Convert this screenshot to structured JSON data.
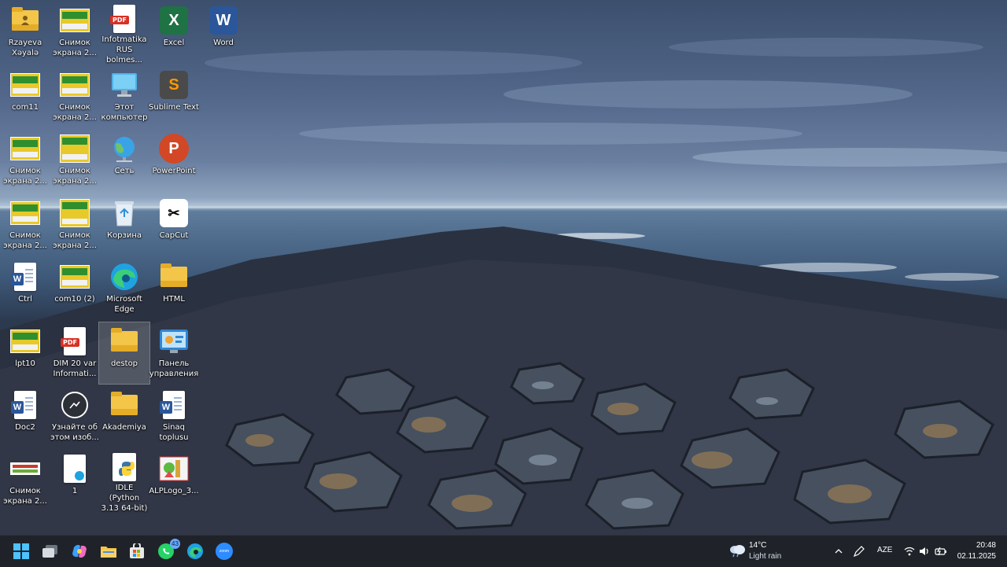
{
  "desktop": {
    "icons": [
      {
        "label": "Rzayeva\nXəyalə",
        "icon": "user-folder-icon"
      },
      {
        "label": "com11",
        "icon": "screenshot-icon"
      },
      {
        "label": "Снимок\nэкрана 2...",
        "icon": "screenshot-icon"
      },
      {
        "label": "Снимок\nэкрана 2...",
        "icon": "screenshot-icon"
      },
      {
        "label": "Ctrl",
        "icon": "word-document-icon"
      },
      {
        "label": "lpt10",
        "icon": "screenshot-icon"
      },
      {
        "label": "Doc2",
        "icon": "word-document-icon"
      },
      {
        "label": "Снимок\nэкрана 2...",
        "icon": "screenshot-icon"
      },
      {
        "label": "Снимок\nэкрана 2...",
        "icon": "screenshot-icon"
      },
      {
        "label": "Снимок\nэкрана 2...",
        "icon": "screenshot-icon"
      },
      {
        "label": "Снимок\nэкрана 2...",
        "icon": "screenshot-icon"
      },
      {
        "label": "Снимок\nэкрана 2...",
        "icon": "screenshot-icon"
      },
      {
        "label": "com10 (2)",
        "icon": "screenshot-icon"
      },
      {
        "label": "DIM 20 var\nInformati...",
        "icon": "pdf-file-icon"
      },
      {
        "label": "Узнайте об\nэтом изоб...",
        "icon": "spotlight-icon"
      },
      {
        "label": "1",
        "icon": "edge-document-icon"
      },
      {
        "label": "Infotmatika\nRUS bolmes...",
        "icon": "pdf-file-icon"
      },
      {
        "label": "Этот\nкомпьютер",
        "icon": "this-pc-icon"
      },
      {
        "label": "Сеть",
        "icon": "network-icon"
      },
      {
        "label": "Корзина",
        "icon": "recycle-bin-icon"
      },
      {
        "label": "Microsoft\nEdge",
        "icon": "edge-icon"
      },
      {
        "label": "destop",
        "icon": "folder-icon"
      },
      {
        "label": "Akademiya",
        "icon": "folder-icon"
      },
      {
        "label": "IDLE (Python\n3.13 64-bit)",
        "icon": "python-icon"
      },
      {
        "label": "Excel",
        "icon": "excel-icon"
      },
      {
        "label": "Sublime Text",
        "icon": "sublime-text-icon"
      },
      {
        "label": "PowerPoint",
        "icon": "powerpoint-icon"
      },
      {
        "label": "CapCut",
        "icon": "capcut-icon"
      },
      {
        "label": "HTML",
        "icon": "folder-icon"
      },
      {
        "label": "Панель\nуправления",
        "icon": "control-panel-icon"
      },
      {
        "label": "Sinaq toplusu",
        "icon": "word-document-icon"
      },
      {
        "label": "ALPLogo_3...",
        "icon": "alplogo-icon"
      },
      {
        "label": "Word",
        "icon": "word-icon"
      }
    ]
  },
  "taskbar": {
    "apps": [
      {
        "name": "start-button"
      },
      {
        "name": "task-view-button"
      },
      {
        "name": "copilot-button"
      },
      {
        "name": "file-explorer-button"
      },
      {
        "name": "microsoft-store-button"
      },
      {
        "name": "whatsapp-button",
        "badge": "43"
      },
      {
        "name": "edge-button"
      },
      {
        "name": "zoom-button",
        "glyph_text": "zoom"
      }
    ],
    "weather": {
      "temp": "14°C",
      "desc": "Light rain"
    },
    "language": "AZE",
    "clock": {
      "time": "20:48",
      "date": "02.11.2025"
    }
  },
  "colors": {
    "taskbar_bg": "#1f2329",
    "folder": "#f3c64a",
    "word": "#2b579a",
    "excel": "#1f7244",
    "powerpoint": "#d24726",
    "sublime": "#ff9800"
  }
}
